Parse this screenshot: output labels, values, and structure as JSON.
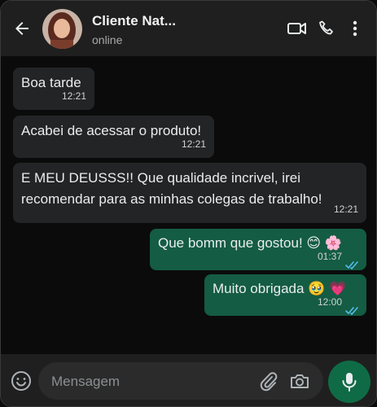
{
  "header": {
    "contact_name": "Cliente Nat...",
    "status": "online",
    "icons": [
      "back-arrow-icon",
      "avatar",
      "video-call-icon",
      "phone-icon",
      "more-vert-icon"
    ]
  },
  "messages": [
    {
      "direction": "in",
      "text": "Boa tarde",
      "time": "12:21"
    },
    {
      "direction": "in",
      "text": "Acabei de acessar o produto!",
      "time": "12:21"
    },
    {
      "direction": "in",
      "text": "E MEU DEUSSS!! Que qualidade incrivel, irei recomendar para as minhas colegas de trabalho!",
      "time": "12:21"
    },
    {
      "direction": "out",
      "text": "Que bomm que gostou! 😊 🌸",
      "time": "01:37",
      "read": true
    },
    {
      "direction": "out",
      "text": "Muito obrigada 🥹 💗",
      "time": "12:00",
      "read": true
    }
  ],
  "composer": {
    "placeholder": "Mensagem",
    "icons": [
      "emoji-icon",
      "attach-icon",
      "camera-icon",
      "mic-icon"
    ]
  },
  "colors": {
    "incoming_bubble": "#232425",
    "outgoing_bubble": "#145c43",
    "mic_button": "#0f6b46",
    "read_ticks": "#53bdeb"
  }
}
